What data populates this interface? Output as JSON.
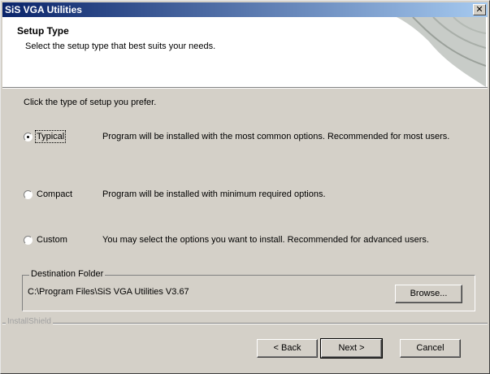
{
  "window": {
    "title": "SiS VGA Utilities",
    "close_glyph": "✕"
  },
  "header": {
    "title": "Setup Type",
    "subtitle": "Select the setup type that best suits your needs."
  },
  "instruction": "Click the type of setup you prefer.",
  "options": [
    {
      "label": "Typical",
      "selected": true,
      "description": "Program will be installed with the most common options. Recommended for most users."
    },
    {
      "label": "Compact",
      "selected": false,
      "description": "Program will be installed with minimum required options."
    },
    {
      "label": "Custom",
      "selected": false,
      "description": "You may select the options you want to install. Recommended for advanced users."
    }
  ],
  "destination": {
    "legend": "Destination Folder",
    "path": "C:\\Program Files\\SiS VGA Utilities V3.67",
    "browse_label": "Browse..."
  },
  "footer": {
    "brand": "InstallShield"
  },
  "buttons": {
    "back": "< Back",
    "next": "Next >",
    "cancel": "Cancel"
  }
}
